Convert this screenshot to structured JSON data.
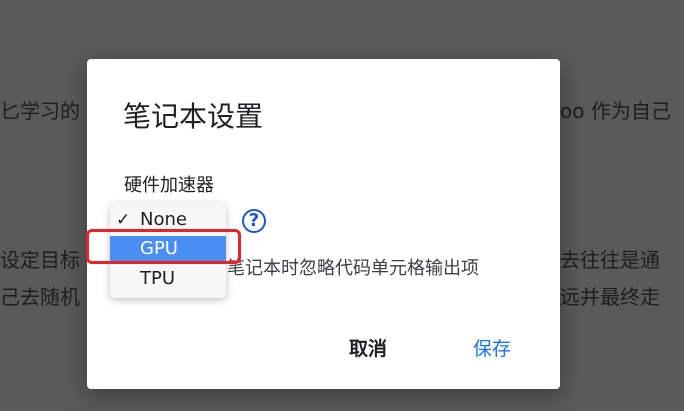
{
  "background": {
    "lines": [
      "匕学习的",
      "oo 作为自己",
      "设定目标",
      "去往往是通",
      "己去随机",
      "远并最终走"
    ]
  },
  "dialog": {
    "title": "笔记本设置",
    "hardware_label": "硬件加速器",
    "help_icon": "question-circle-icon",
    "omit_output_label": "笔记本时忽略代码单元格输出项",
    "cancel_label": "取消",
    "save_label": "保存"
  },
  "dropdown": {
    "options": [
      {
        "label": "None",
        "checked": true,
        "check_mark": "✓"
      },
      {
        "label": "GPU",
        "checked": false,
        "highlighted": true
      },
      {
        "label": "TPU",
        "checked": false
      }
    ],
    "highlight_color": "#e4242a",
    "selected_bg": "#4a8ef2"
  },
  "colors": {
    "accent": "#1a73e8",
    "help_icon": "#1a57c8"
  }
}
